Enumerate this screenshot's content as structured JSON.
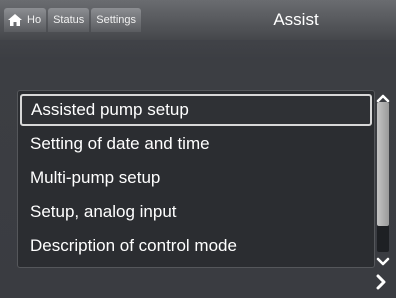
{
  "header": {
    "tabs": [
      {
        "label": "Ho",
        "icon": "home-icon"
      },
      {
        "label": "Status"
      },
      {
        "label": "Settings"
      }
    ],
    "title": "Assist"
  },
  "menu": {
    "items": [
      {
        "label": "Assisted pump setup",
        "selected": true
      },
      {
        "label": "Setting of date and time"
      },
      {
        "label": "Multi-pump setup"
      },
      {
        "label": "Setup, analog input"
      },
      {
        "label": "Description of control mode"
      }
    ]
  },
  "scrollbar": {
    "up_icon": "chevron-up-icon",
    "down_icon": "chevron-down-icon",
    "position": 0
  },
  "navigation": {
    "next_icon": "chevron-right-icon"
  },
  "colors": {
    "background": "#3c3e43",
    "text": "#ffffff",
    "selection_border": "#d8d8d8",
    "scroll_thumb": "#b0b0b0"
  }
}
